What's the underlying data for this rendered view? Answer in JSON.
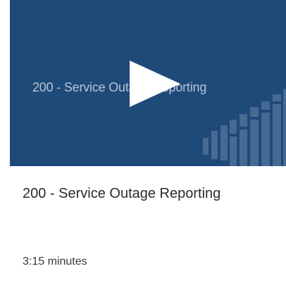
{
  "card": {
    "thumbnail_text": "200 - Service Outage Reporting",
    "title": "200 - Service Outage Reporting",
    "duration": "3:15 minutes",
    "play_icon": "play-icon",
    "thumbnail_background": "#1e4a7a"
  }
}
